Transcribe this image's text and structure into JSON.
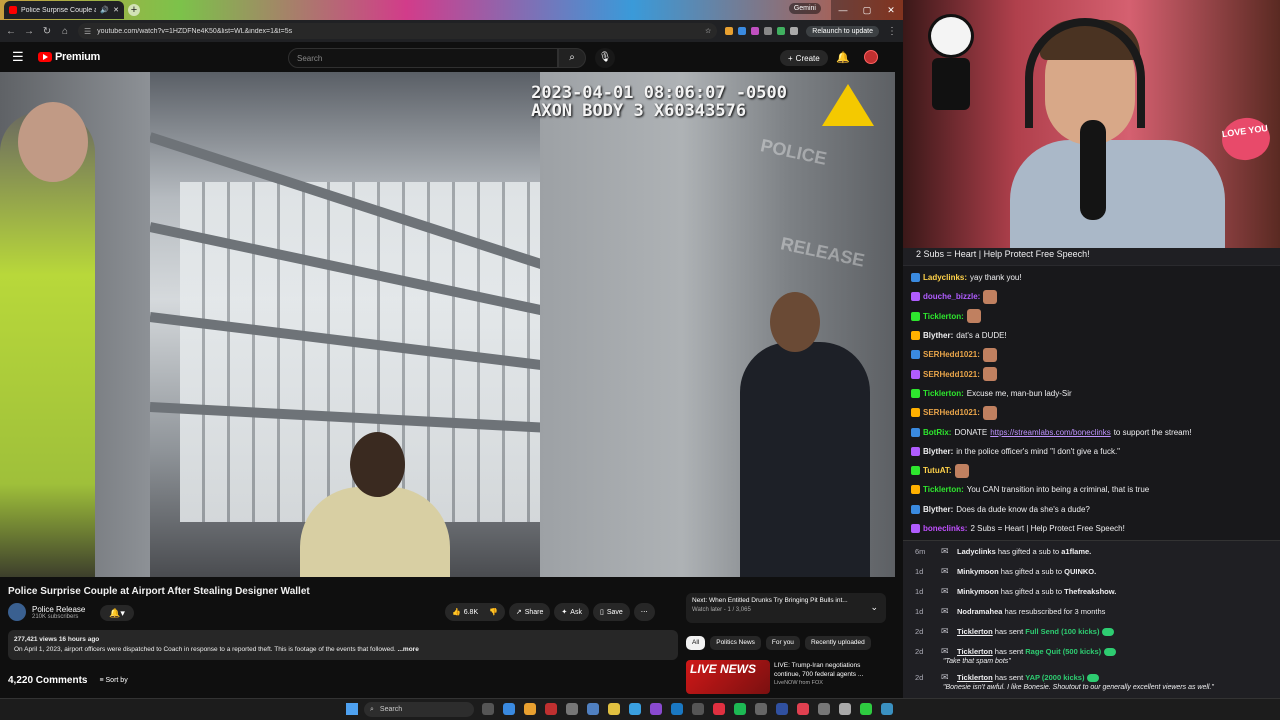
{
  "browser": {
    "tab_title": "Police Surprise Couple at A",
    "gemini_label": "Gemini",
    "url": "youtube.com/watch?v=1HZDFNe4K50&list=WL&index=1&t=5s",
    "relaunch_label": "Relaunch to update"
  },
  "youtube": {
    "logo_text": "Premium",
    "search_placeholder": "Search",
    "create_label": "Create",
    "video": {
      "overlay_line1": "2023-04-01 08:06:07 -0500",
      "overlay_line2": "AXON BODY 3 X60343576",
      "watermark1": "POLICE",
      "watermark2": "RELEASE"
    },
    "title": "Police Surprise Couple at Airport After Stealing Designer Wallet",
    "channel": {
      "name": "Police Release",
      "subs": "210K subscribers"
    },
    "actions": {
      "likes": "6.8K",
      "share": "Share",
      "ask": "Ask",
      "save": "Save",
      "more": "⋯"
    },
    "description": {
      "stats": "277,421 views  16 hours ago",
      "text": "On April 1, 2023, airport officers were dispatched to Coach in response to a reported theft. This is footage of the events that followed.",
      "more": "...more"
    },
    "comments": {
      "count": "4,220 Comments",
      "sort": "Sort by"
    },
    "up_next": {
      "title": "Next: When Entitled Drunks Try Bringing Pit Bulls int...",
      "sub": "Watch later - 1 / 3,065"
    },
    "chips": [
      "All",
      "Politics News",
      "For you",
      "Recently uploaded"
    ],
    "rec": {
      "thumb_text": "LIVE NEWS",
      "title": "LIVE: Trump-Iran negotiations continue, 700 federal agents ...",
      "channel": "LiveNOW from FOX"
    }
  },
  "taskbar": {
    "search": "Search"
  },
  "stream": {
    "love_sign": "LOVE YOU",
    "pinned": "2 Subs = Heart | Help Protect Free Speech!",
    "chat": [
      {
        "user": "Ladyclinks",
        "color": "#ffd24a",
        "text": "yay thank you!"
      },
      {
        "user": "douche_bizzle",
        "color": "#b05cff",
        "text": ""
      },
      {
        "user": "Ticklerton",
        "color": "#2ee62e",
        "text": ""
      },
      {
        "user": "Blyther",
        "color": "#efeff1",
        "text": "dat's a DUDE!"
      },
      {
        "user": "SERHedd1021",
        "color": "#e8a44a",
        "text": ""
      },
      {
        "user": "SERHedd1021",
        "color": "#e8a44a",
        "text": ""
      },
      {
        "user": "Ticklerton",
        "color": "#2ee62e",
        "text": "Excuse me, man-bun lady-Sir"
      },
      {
        "user": "SERHedd1021",
        "color": "#e8a44a",
        "text": ""
      },
      {
        "user": "BotRix",
        "color": "#2ee62e",
        "text": "DONATE",
        "link": "https://streamlabs.com/boneclinks",
        "after": "to support the stream!"
      },
      {
        "user": "Blyther",
        "color": "#efeff1",
        "text": "in the police officer's mind \"I don't give a fuck.\""
      },
      {
        "user": "TutuAT",
        "color": "#ffd24a",
        "text": ""
      },
      {
        "user": "Ticklerton",
        "color": "#2ee62e",
        "text": "You CAN transition into being a criminal, that is true"
      },
      {
        "user": "Blyther",
        "color": "#efeff1",
        "text": "Does da dude know da she's a dude?"
      },
      {
        "user": "boneclinks",
        "color": "#c050ff",
        "text": "2 Subs = Heart | Help Protect Free Speech!"
      }
    ],
    "events": [
      {
        "time": "6m",
        "user": "Ladyclinks",
        "action": "has gifted a sub to",
        "target": "a1flame."
      },
      {
        "time": "1d",
        "user": "Minkymoon",
        "action": "has gifted a sub to",
        "target": "QUINKO."
      },
      {
        "time": "1d",
        "user": "Minkymoon",
        "action": "has gifted a sub to",
        "target": "Thefreakshow."
      },
      {
        "time": "1d",
        "user": "Nodramahea",
        "action": "has resubscribed for 3 months",
        "target": ""
      },
      {
        "time": "2d",
        "user": "Ticklerton",
        "action": "has sent",
        "amount": "Full Send (100 kicks)"
      },
      {
        "time": "2d",
        "user": "Ticklerton",
        "action": "has sent",
        "amount": "Rage Quit (500 kicks)",
        "quote": "\"Take that spam bots\""
      },
      {
        "time": "2d",
        "user": "Ticklerton",
        "action": "has sent",
        "amount": "YAP (2000 kicks)",
        "quote": "\"Bonesie isn't awful. I like Bonesie. Shoutout to our generally excellent viewers as well.\""
      }
    ]
  }
}
